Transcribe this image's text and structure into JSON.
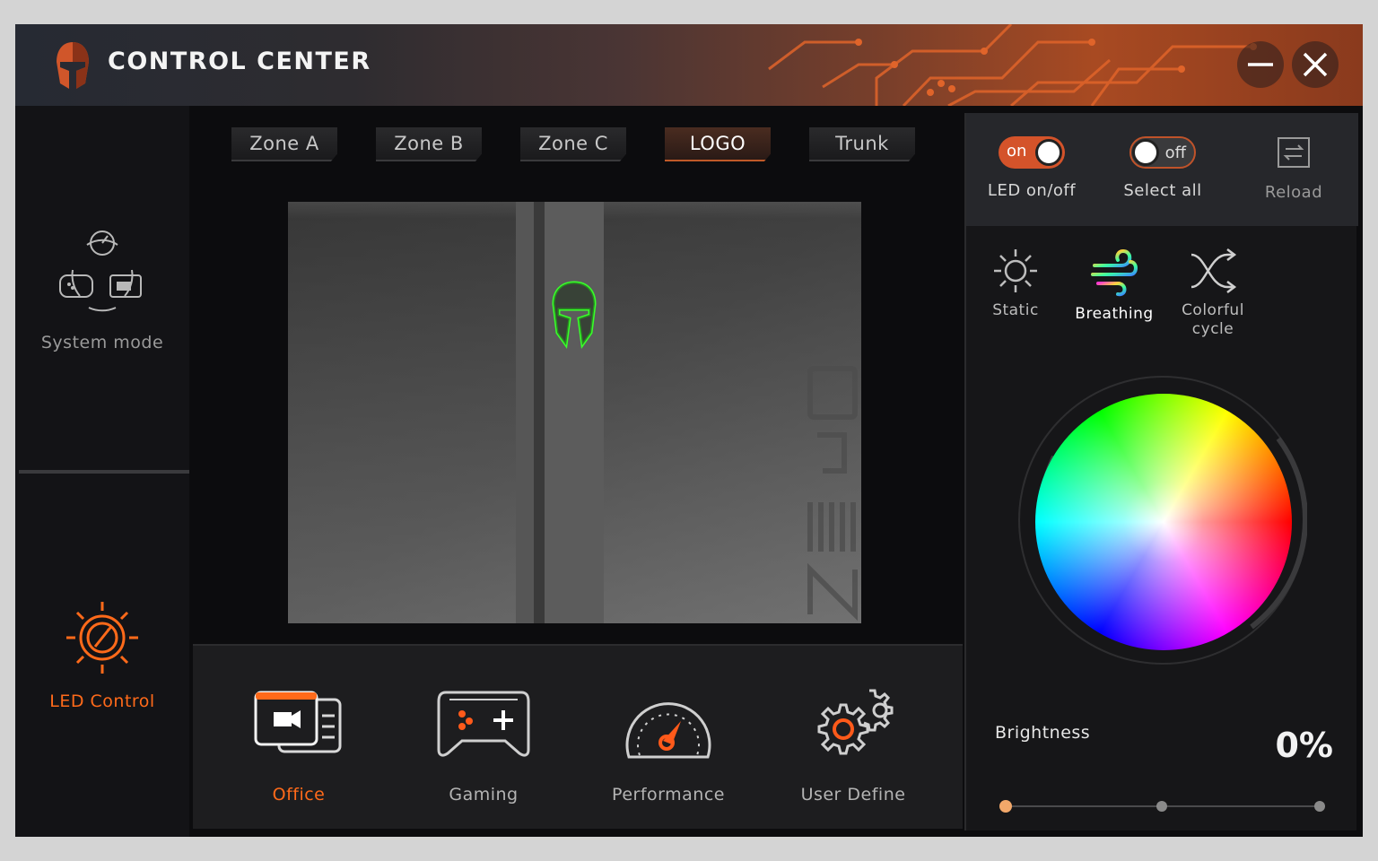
{
  "app": {
    "title": "CONTROL CENTER"
  },
  "sidebar": {
    "items": [
      {
        "label": "System mode",
        "active": false,
        "icon": "system-mode-icon"
      },
      {
        "label": "LED Control",
        "active": true,
        "icon": "led-control-icon"
      }
    ]
  },
  "zones": {
    "tabs": [
      "Zone A",
      "Zone B",
      "Zone C",
      "LOGO",
      "Trunk"
    ],
    "active": "LOGO"
  },
  "profiles": {
    "items": [
      {
        "label": "Office",
        "active": true,
        "icon": "office-icon"
      },
      {
        "label": "Gaming",
        "active": false,
        "icon": "gamepad-icon"
      },
      {
        "label": "Performance",
        "active": false,
        "icon": "speedometer-icon"
      },
      {
        "label": "User Define",
        "active": false,
        "icon": "gears-icon"
      }
    ]
  },
  "controls": {
    "led_toggle": {
      "state": "on",
      "label": "LED on/off"
    },
    "select_all": {
      "state": "off",
      "label": "Select all"
    },
    "reload": {
      "label": "Reload"
    }
  },
  "effects": {
    "items": [
      "Static",
      "Breathing",
      "Colorful cycle"
    ],
    "active": "Breathing"
  },
  "brightness": {
    "label": "Brightness",
    "value": "0%",
    "level": 0
  },
  "colors": {
    "accent": "#ff6a1a",
    "logo_glow": "#39ff2a"
  }
}
